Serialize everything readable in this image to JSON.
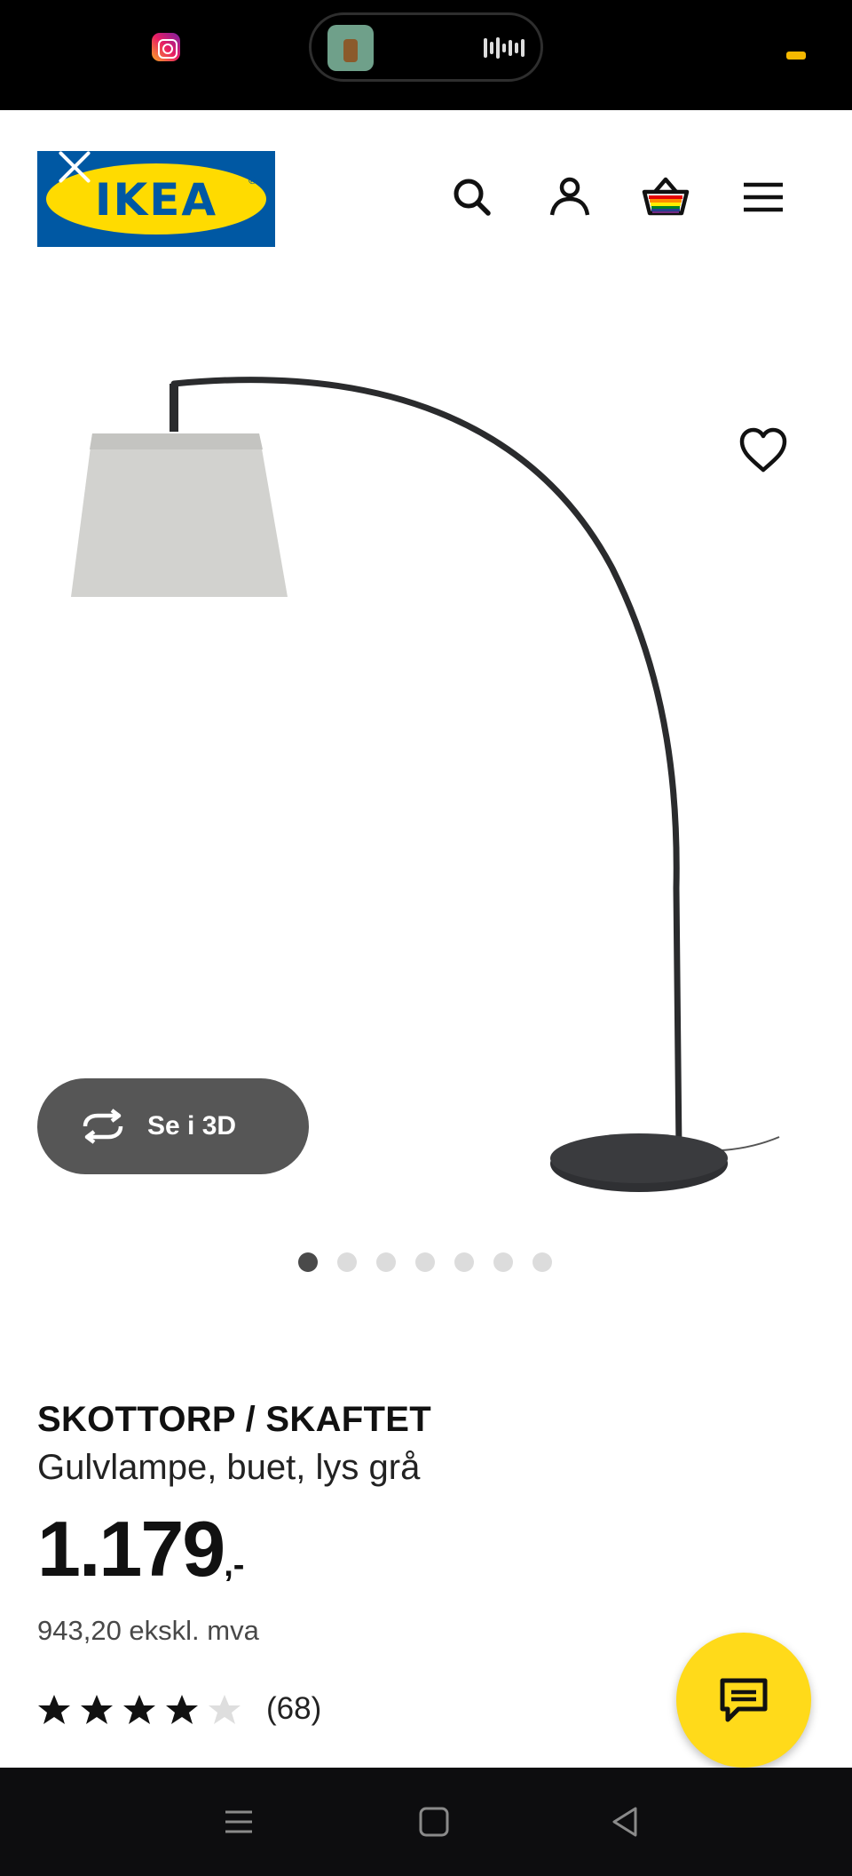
{
  "status_bar": {
    "left_icon": "instagram-icon",
    "island_thumbnail": "media-thumbnail",
    "island_indicator": "audio-waveform-icon"
  },
  "header": {
    "logo_text": "IKEA",
    "logo_reg": "®",
    "colors": {
      "logo_blue": "#0058a3",
      "logo_yellow": "#ffdb00"
    },
    "icons": [
      "close-icon",
      "search-icon",
      "user-icon",
      "basket-icon",
      "menu-icon"
    ]
  },
  "product": {
    "name": "SKOTTORP / SKAFTET",
    "description": "Gulvlampe, buet, lys grå",
    "price_main": "1.179",
    "price_suffix": ",-",
    "price_excl_vat": "943,20 ekskl. mva",
    "rating": 4,
    "rating_max": 5,
    "review_count": "(68)",
    "image_count": 7,
    "active_image": 1
  },
  "buttons": {
    "view_3d": "Se i 3D"
  },
  "colors": {
    "chat_button": "#ffda1a",
    "view_3d_button": "#565656"
  },
  "navbar": {
    "icons": [
      "recents-icon",
      "home-icon",
      "back-icon"
    ]
  }
}
